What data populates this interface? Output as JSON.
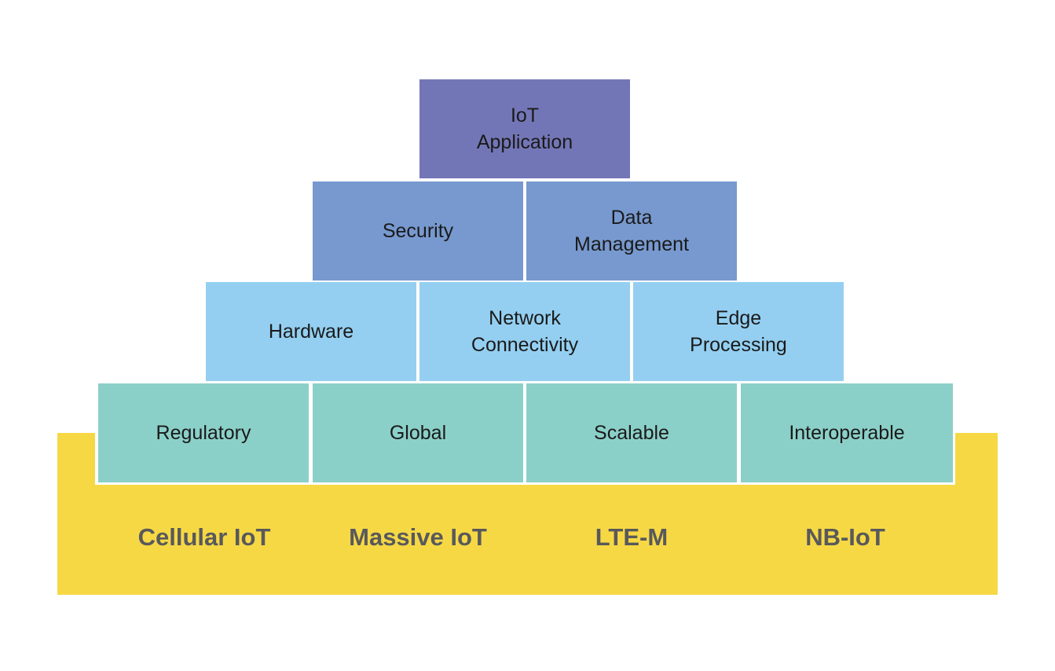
{
  "diagram": {
    "type": "pyramid",
    "title": "",
    "levels": [
      {
        "name": "top",
        "color": "#7376b6",
        "blocks": [
          "IoT\nApplication"
        ]
      },
      {
        "name": "second",
        "color": "#7799cf",
        "blocks": [
          "Security",
          "Data\nManagement"
        ]
      },
      {
        "name": "third",
        "color": "#94cff1",
        "blocks": [
          "Hardware",
          "Network\nConnectivity",
          "Edge\nProcessing"
        ]
      },
      {
        "name": "fourth",
        "color": "#8bd0c8",
        "blocks": [
          "Regulatory",
          "Global",
          "Scalable",
          "Interoperable"
        ]
      }
    ],
    "base": {
      "color": "#f6d845",
      "text_color": "#58595b",
      "labels": [
        "Cellular IoT",
        "Massive IoT",
        "LTE-M",
        "NB-IoT"
      ]
    }
  }
}
